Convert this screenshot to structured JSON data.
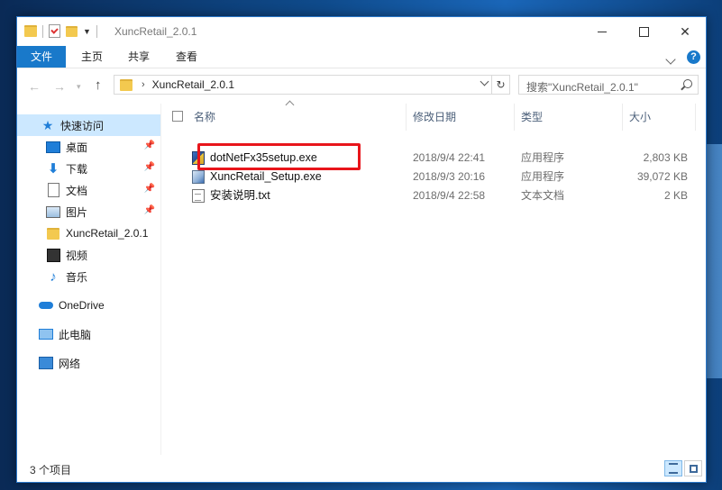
{
  "window": {
    "title": "XuncRetail_2.0.1",
    "controls": [
      "minimize",
      "maximize",
      "close"
    ]
  },
  "ribbon": {
    "tabs": [
      {
        "label": "文件",
        "active": true
      },
      {
        "label": "主页"
      },
      {
        "label": "共享"
      },
      {
        "label": "查看"
      }
    ],
    "help_label": "?"
  },
  "address": {
    "chevron": "›",
    "path": "XuncRetail_2.0.1",
    "search_placeholder": "搜索\"XuncRetail_2.0.1\""
  },
  "nav": {
    "items": [
      {
        "label": "快速访问",
        "icon": "star-icon",
        "selected": true
      },
      {
        "label": "桌面",
        "icon": "desktop-icon",
        "pinned": true
      },
      {
        "label": "下载",
        "icon": "download-icon",
        "pinned": true
      },
      {
        "label": "文档",
        "icon": "document-icon",
        "pinned": true
      },
      {
        "label": "图片",
        "icon": "pictures-icon",
        "pinned": true
      },
      {
        "label": "XuncRetail_2.0.1",
        "icon": "folder-icon"
      },
      {
        "label": "视频",
        "icon": "video-icon"
      },
      {
        "label": "音乐",
        "icon": "music-icon"
      },
      {
        "label": "OneDrive",
        "icon": "onedrive-icon"
      },
      {
        "label": "此电脑",
        "icon": "this-pc-icon"
      },
      {
        "label": "网络",
        "icon": "network-icon"
      }
    ]
  },
  "list": {
    "columns": {
      "name": "名称",
      "date": "修改日期",
      "type": "类型",
      "size": "大小"
    },
    "files": [
      {
        "name": "dotNetFx35setup.exe",
        "date": "2018/9/4 22:41",
        "type": "应用程序",
        "size": "2,803 KB",
        "icon": "exe-installer-icon",
        "highlighted": true
      },
      {
        "name": "XuncRetail_Setup.exe",
        "date": "2018/9/3 20:16",
        "type": "应用程序",
        "size": "39,072 KB",
        "icon": "setup-exe-icon"
      },
      {
        "name": "安装说明.txt",
        "date": "2018/9/4 22:58",
        "type": "文本文档",
        "size": "2 KB",
        "icon": "text-file-icon"
      }
    ]
  },
  "status": {
    "item_count": "3 个项目"
  },
  "colors": {
    "accent": "#1979ca",
    "selected": "#cce8ff",
    "highlight_box": "#e8151b"
  }
}
